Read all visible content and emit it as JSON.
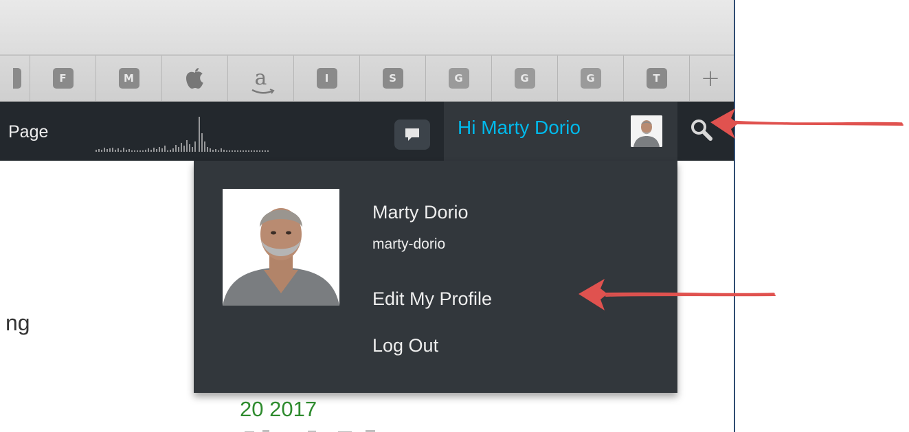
{
  "bookmarks": [
    {
      "label": "",
      "type": "stub"
    },
    {
      "label": "F",
      "type": "square"
    },
    {
      "label": "M",
      "type": "square"
    },
    {
      "label": "",
      "type": "apple",
      "icon": "apple-icon"
    },
    {
      "label": "a",
      "type": "amazon",
      "icon": "amazon-icon"
    },
    {
      "label": "I",
      "type": "square"
    },
    {
      "label": "S",
      "type": "square"
    },
    {
      "label": "G",
      "type": "square"
    },
    {
      "label": "G",
      "type": "square"
    },
    {
      "label": "G",
      "type": "square"
    },
    {
      "label": "T",
      "type": "square"
    },
    {
      "label": "+",
      "type": "plus",
      "icon": "plus-icon"
    }
  ],
  "adminbar": {
    "page_label": "Page",
    "howdy": "Hi Marty Dorio",
    "icons": [
      "comment-icon",
      "search-icon"
    ]
  },
  "dropdown": {
    "display_name": "Marty Dorio",
    "username": "marty-dorio",
    "edit_profile": "Edit My Profile",
    "logout": "Log Out"
  },
  "content": {
    "partial_heading": "ng",
    "date": "20 2017"
  },
  "colors": {
    "adminbar_bg": "#23282d",
    "account_bg": "#32373c",
    "howdy_text": "#00b9eb",
    "annotation_arrow": "#e0524f",
    "date_text": "#2e8b2e"
  }
}
